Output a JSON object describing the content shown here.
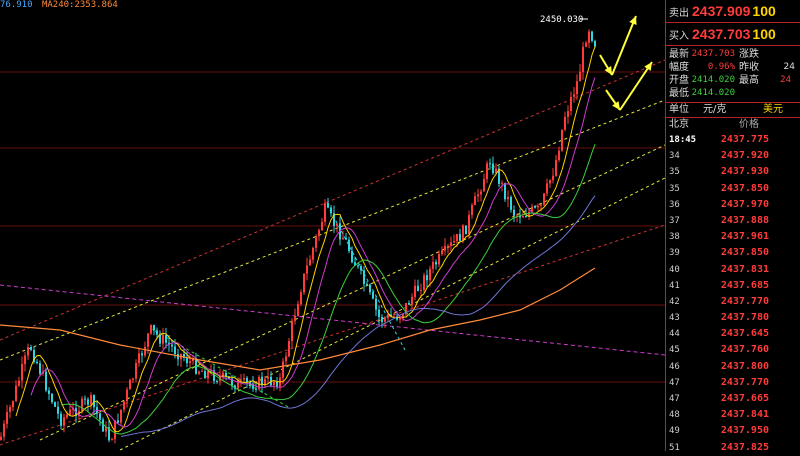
{
  "ma_legend": [
    {
      "text": "76.910",
      "color": "#4aa8ff"
    },
    {
      "text": "MA240:2353.864",
      "color": "#ff8a3b"
    }
  ],
  "chart_data": {
    "type": "candlestick",
    "peak_label": "2450.030",
    "colors": {
      "up": "#ff3b3b",
      "down": "#2fd6e0",
      "ma_yellow": "#ffd400",
      "ma_green": "#3bd03b",
      "ma_blue": "#6f76d8",
      "ma_magenta": "#d03bd0",
      "ma_orange": "#ff8a3b",
      "arrow": "#ffff3b"
    }
  },
  "panel": {
    "sell": {
      "label": "卖出",
      "price": "2437.909",
      "vol": "100"
    },
    "buy": {
      "label": "买入",
      "price": "2437.703",
      "vol": "100"
    },
    "stats": {
      "latest_label": "最新",
      "latest": "2437.703",
      "change_label": "涨跌",
      "change": "",
      "range_label": "幅度",
      "range": "0.96%",
      "prev_label": "昨收",
      "prev": "24",
      "open_label": "开盘",
      "open": "2414.020",
      "high_label": "最高",
      "high": "24",
      "low_label": "最低",
      "low": "2414.020"
    },
    "unit_label": "单位",
    "unit": "元/克",
    "currency": "美元",
    "ticks_head": {
      "city": "北京",
      "price": "价格"
    },
    "ticks": [
      {
        "t": "18:45",
        "p": "2437.775"
      },
      {
        "t": "34",
        "p": "2437.920"
      },
      {
        "t": "35",
        "p": "2437.930"
      },
      {
        "t": "35",
        "p": "2437.850"
      },
      {
        "t": "36",
        "p": "2437.970"
      },
      {
        "t": "37",
        "p": "2437.888"
      },
      {
        "t": "38",
        "p": "2437.961"
      },
      {
        "t": "39",
        "p": "2437.850"
      },
      {
        "t": "40",
        "p": "2437.831"
      },
      {
        "t": "41",
        "p": "2437.685"
      },
      {
        "t": "42",
        "p": "2437.770"
      },
      {
        "t": "43",
        "p": "2437.780"
      },
      {
        "t": "44",
        "p": "2437.645"
      },
      {
        "t": "45",
        "p": "2437.760"
      },
      {
        "t": "46",
        "p": "2437.800"
      },
      {
        "t": "47",
        "p": "2437.770"
      },
      {
        "t": "47",
        "p": "2437.665"
      },
      {
        "t": "48",
        "p": "2437.841"
      },
      {
        "t": "49",
        "p": "2437.950"
      },
      {
        "t": "51",
        "p": "2437.825"
      }
    ]
  }
}
